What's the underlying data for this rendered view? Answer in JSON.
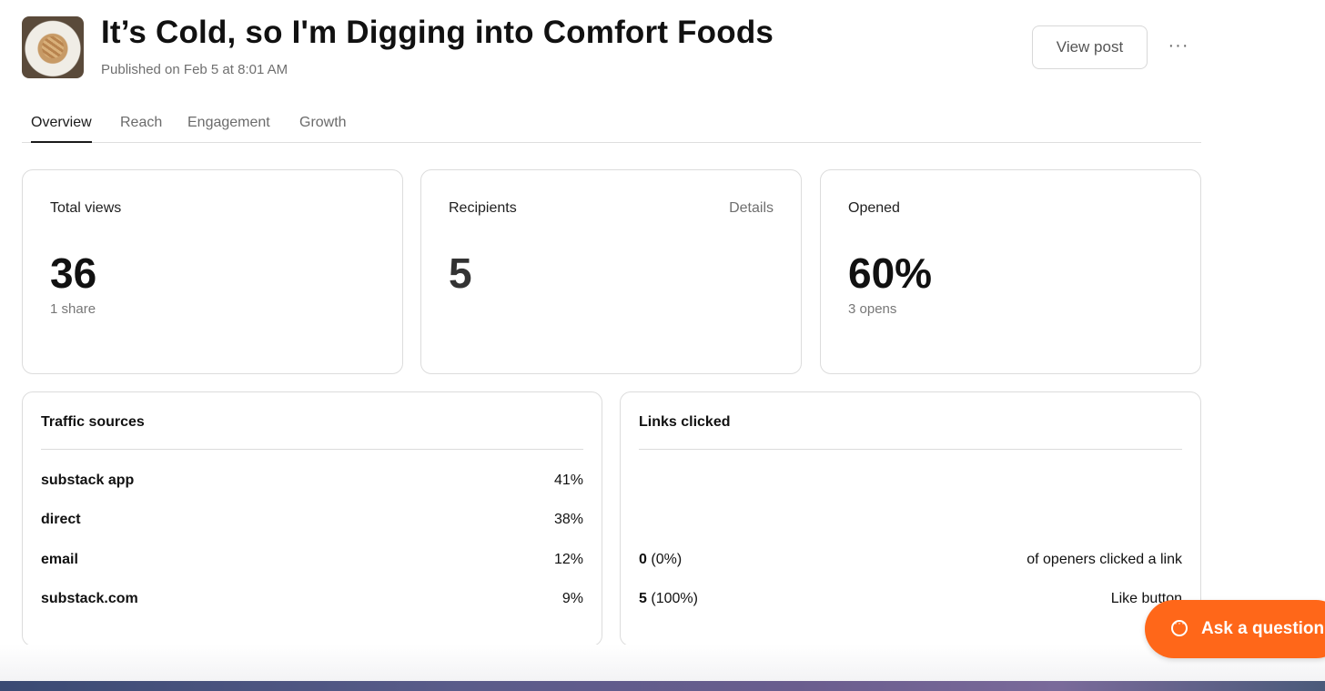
{
  "post": {
    "title": "It’s Cold, so I'm Digging into Comfort Foods",
    "published": "Published on Feb 5 at 8:01 AM"
  },
  "actions": {
    "view_post": "View post",
    "more": "···"
  },
  "tabs": [
    {
      "label": "Overview",
      "active": true
    },
    {
      "label": "Reach"
    },
    {
      "label": "Engagement"
    },
    {
      "label": "Growth"
    }
  ],
  "stats": {
    "total_views": {
      "label": "Total views",
      "value": "36",
      "sub": "1 share"
    },
    "recipients": {
      "label": "Recipients",
      "link": "Details",
      "value": "5"
    },
    "opened": {
      "label": "Opened",
      "value": "60%",
      "sub": "3 opens"
    }
  },
  "traffic_sources": {
    "title": "Traffic sources",
    "rows": [
      {
        "name": "substack app",
        "pct": "41%"
      },
      {
        "name": "direct",
        "pct": "38%"
      },
      {
        "name": "email",
        "pct": "12%"
      },
      {
        "name": "substack.com",
        "pct": "9%"
      }
    ]
  },
  "links_clicked": {
    "title": "Links clicked",
    "rows": [
      {
        "count": "0",
        "pct": "(0%)",
        "desc": "of openers clicked a link"
      },
      {
        "count": "5",
        "pct": "(100%)",
        "desc": "Like button"
      }
    ]
  },
  "help": {
    "ask_label": "Ask a question"
  },
  "colors": {
    "accent": "#ff6719",
    "border": "#dcdcdc",
    "muted_text": "#6f6f6f"
  },
  "icons": {
    "thumbnail": "food-thumbnail",
    "more": "more-dots-icon",
    "chat": "chat-bubble-icon"
  }
}
